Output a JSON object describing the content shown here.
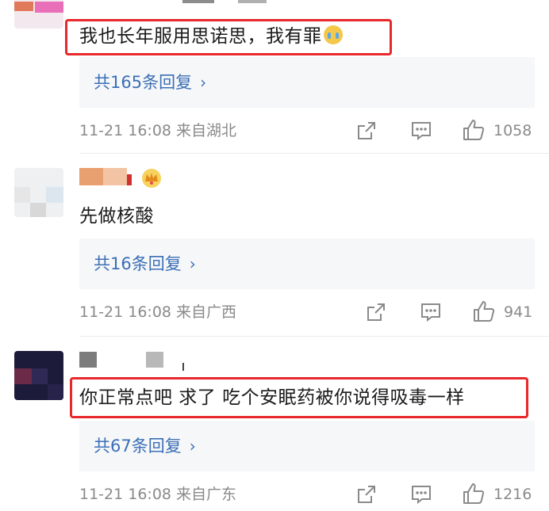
{
  "comments": [
    {
      "text": "我也长年服用思诺思，我有罪",
      "replies_label": "共165条回复",
      "time": "11-21 16:08 来自湖北",
      "likes": "1058",
      "highlighted": true,
      "emoji": "crying-emoji"
    },
    {
      "text": "先做核酸",
      "replies_label": "共16条回复",
      "time": "11-21 16:08 来自广西",
      "likes": "941",
      "highlighted": false,
      "badges": [
        "exclamation",
        "crown-icon"
      ]
    },
    {
      "text": "你正常点吧 求了 吃个安眠药被你说得吸毒一样",
      "replies_label": "共67条回复",
      "time": "11-21 16:08 来自广东",
      "likes": "1216",
      "highlighted": true
    }
  ],
  "colors": {
    "link": "#3b6fb5",
    "highlight_border": "#e8282b",
    "meta_text": "#8a8a8a",
    "reply_bg": "#f6f7f9"
  },
  "icons": {
    "share": "share-icon",
    "comment": "comment-icon",
    "like": "thumbs-up-icon",
    "chevron": "chevron-right-icon"
  }
}
